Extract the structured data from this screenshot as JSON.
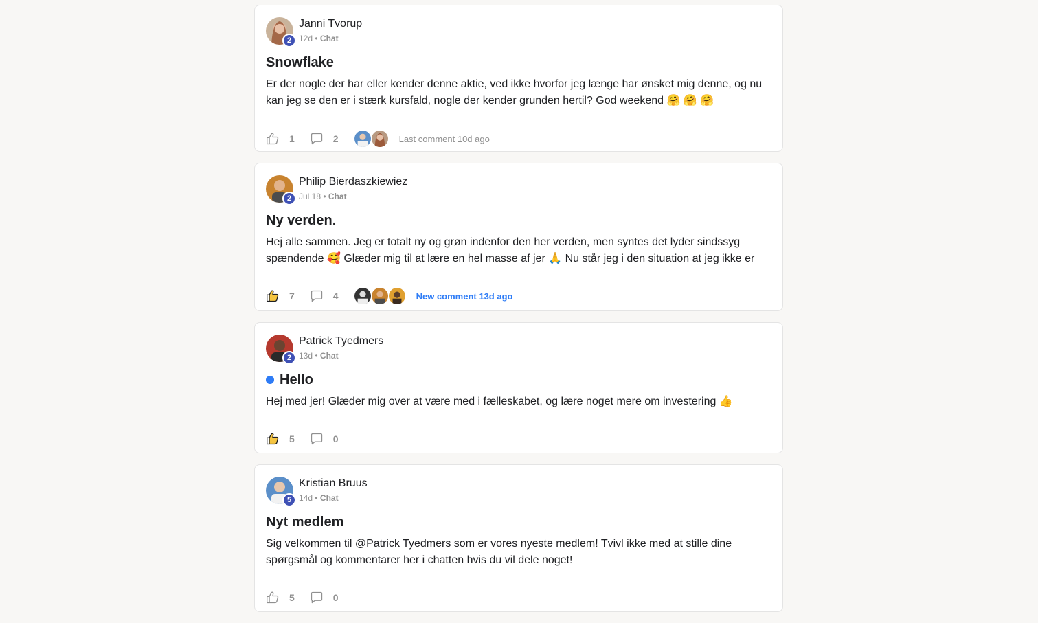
{
  "posts": [
    {
      "author": "Janni Tvorup",
      "level": "2",
      "time": "12d",
      "category": "Chat",
      "title": "Snowflake",
      "unread": false,
      "body": "Er der nogle der har eller kender denne aktie, ved ikke hvorfor jeg længe har ønsket mig denne, og nu kan jeg se den er i stærk kursfald, nogle der kender grunden hertil? God weekend 🤗 🤗 🤗",
      "likes": "1",
      "liked": false,
      "comments": "2",
      "comment_status": "Last comment 10d ago",
      "comment_status_new": false
    },
    {
      "author": "Philip Bierdaszkiewiez",
      "level": "2",
      "time": "Jul 18",
      "category": "Chat",
      "title": "Ny verden.",
      "unread": false,
      "body": "Hej alle sammen. Jeg er totalt ny og grøn indenfor den her verden, men syntes det lyder sindssyg spændende 🥰 Glæder mig til at lære en hel masse af jer 🙏 Nu står jeg i den situation at jeg ikke er den",
      "likes": "7",
      "liked": true,
      "comments": "4",
      "comment_status": "New comment 13d ago",
      "comment_status_new": true
    },
    {
      "author": "Patrick Tyedmers",
      "level": "2",
      "time": "13d",
      "category": "Chat",
      "title": "Hello",
      "unread": true,
      "body": "Hej med jer! Glæder mig over at være med i fælleskabet, og lære noget mere om investering 👍",
      "likes": "5",
      "liked": true,
      "comments": "0",
      "comment_status": "",
      "comment_status_new": false
    },
    {
      "author": "Kristian Bruus",
      "level": "5",
      "time": "14d",
      "category": "Chat",
      "title": "Nyt medlem",
      "unread": false,
      "body": "Sig velkommen til @Patrick Tyedmers som er vores nyeste medlem! Tvivl ikke med at stille dine spørgsmål og kommentarer her i chatten hvis du vil dele noget!",
      "likes": "5",
      "liked": false,
      "comments": "0",
      "comment_status": "",
      "comment_status_new": false
    }
  ],
  "meta_separator": "•",
  "colors": {
    "accent": "#2e7cf6",
    "level_badge": "#3f51b5",
    "liked_fill": "#f5c542"
  }
}
